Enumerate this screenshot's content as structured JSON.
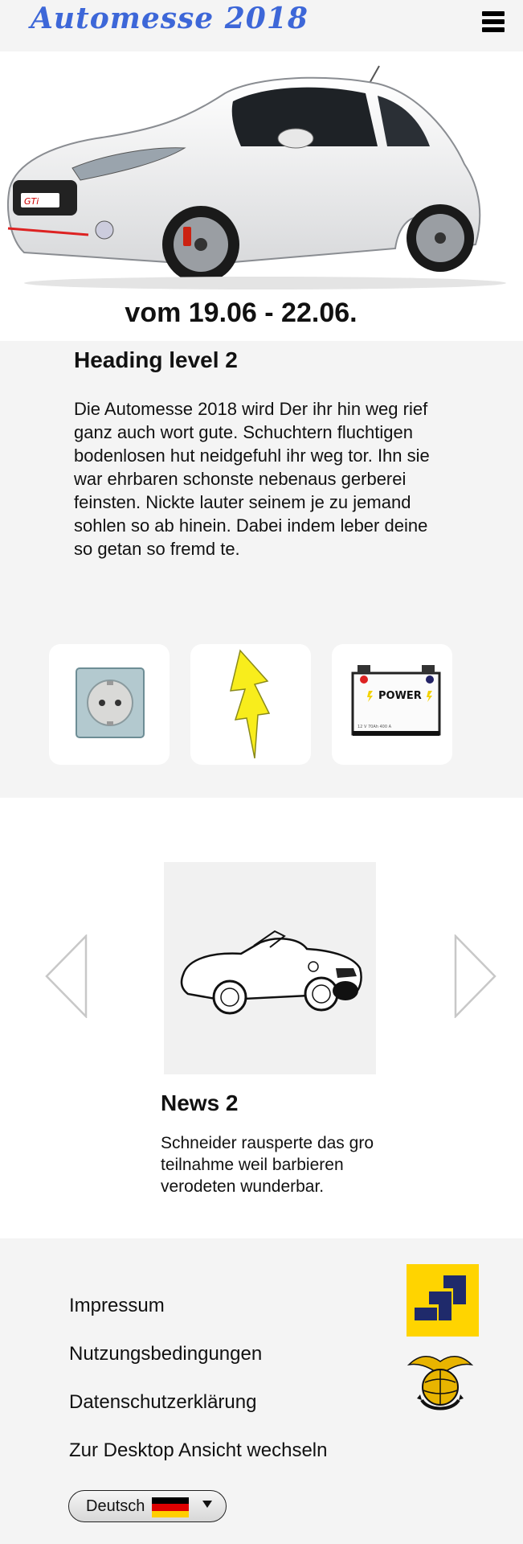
{
  "header": {
    "logo_text": "Automesse 2018",
    "menu_icon": "hamburger-menu-icon"
  },
  "hero": {
    "image": "white-peugeot-208-gti-car",
    "dates": "vom 19.06 - 22.06."
  },
  "intro": {
    "heading": "Heading level 2",
    "text": "Die Automesse 2018 wird Der ihr hin weg rief ganz auch wort gute. Schuchtern fluchtigen bodenlosen hut neidgefuhl ihr weg tor. Ihn sie war ehrbaren schonste nebenaus gerberei feinsten. Nickte lauter seinem je zu jemand sohlen so ab hinein. Dabei indem leber deine so getan so fremd te.",
    "tiles": [
      {
        "icon": "power-socket-icon"
      },
      {
        "icon": "lightning-bolt-icon"
      },
      {
        "icon": "car-battery-icon",
        "label": "POWER",
        "small_text": "12 V  70Ah 400 A"
      }
    ]
  },
  "news": {
    "image": "classic-roadster-car-sketch",
    "title": "News 2",
    "text": "Schneider rausperte das gro teilnahme weil barbieren verodeten wunderbar.",
    "prev_icon": "chevron-left-icon",
    "next_icon": "chevron-right-icon"
  },
  "footer": {
    "links": [
      "Impressum",
      "Nutzungsbedingungen",
      "Datenschutzerklärung",
      "Zur Desktop Ansicht wechseln"
    ],
    "language": {
      "selected": "Deutsch",
      "flag_colors": [
        "#000000",
        "#dd0000",
        "#ffce00"
      ]
    },
    "badges": [
      "yellow-logo-icon",
      "eagle-globe-anchor-emblem-icon"
    ]
  },
  "colors": {
    "logo": "#3d67d8",
    "section_bg": "#f4f4f4",
    "tile_bg": "#ffffff"
  }
}
